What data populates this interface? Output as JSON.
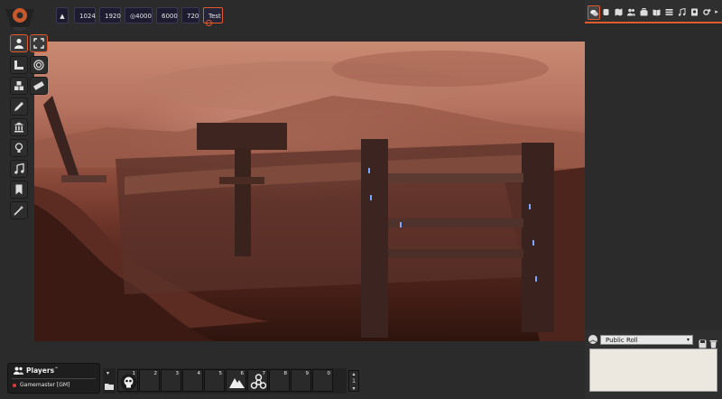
{
  "scene_nav": {
    "items": [
      {
        "label": "1024"
      },
      {
        "label": "1920"
      },
      {
        "label": "4000",
        "icon": "target-icon"
      },
      {
        "label": "6000"
      },
      {
        "label": "720"
      },
      {
        "label": "Test",
        "active": true
      }
    ]
  },
  "left_controls": [
    {
      "name": "token-controls",
      "icon": "user-icon",
      "active": true
    },
    {
      "name": "measure-controls",
      "icon": "ruler-icon"
    },
    {
      "name": "tile-controls",
      "icon": "cubes-icon"
    },
    {
      "name": "drawing-controls",
      "icon": "pencil-icon"
    },
    {
      "name": "wall-controls",
      "icon": "building-columns-icon"
    },
    {
      "name": "lighting-controls",
      "icon": "lightbulb-icon"
    },
    {
      "name": "sound-controls",
      "icon": "music-icon"
    },
    {
      "name": "notes-controls",
      "icon": "bookmark-icon"
    },
    {
      "name": "magic-controls",
      "icon": "wand-icon"
    }
  ],
  "sub_controls": [
    {
      "name": "select-targets",
      "icon": "expand-icon",
      "active": true
    },
    {
      "name": "target-tool",
      "icon": "bullseye-icon"
    },
    {
      "name": "ruler-tool",
      "icon": "ruler-horizontal-icon"
    }
  ],
  "sidebar": {
    "tabs": [
      "chat",
      "combat",
      "scenes",
      "actors",
      "items",
      "journal",
      "tables",
      "playlists",
      "compendium",
      "settings"
    ],
    "roll_mode": "Public Roll"
  },
  "players": {
    "title": "Players",
    "users": [
      {
        "name": "Gamemaster [GM]",
        "color": "#e03a3a"
      }
    ]
  },
  "hotbar": {
    "slots": [
      "1",
      "2",
      "3",
      "4",
      "5",
      "6",
      "7",
      "8",
      "9",
      "0"
    ],
    "page": "1"
  },
  "colors": {
    "accent": "#e05a2b"
  }
}
